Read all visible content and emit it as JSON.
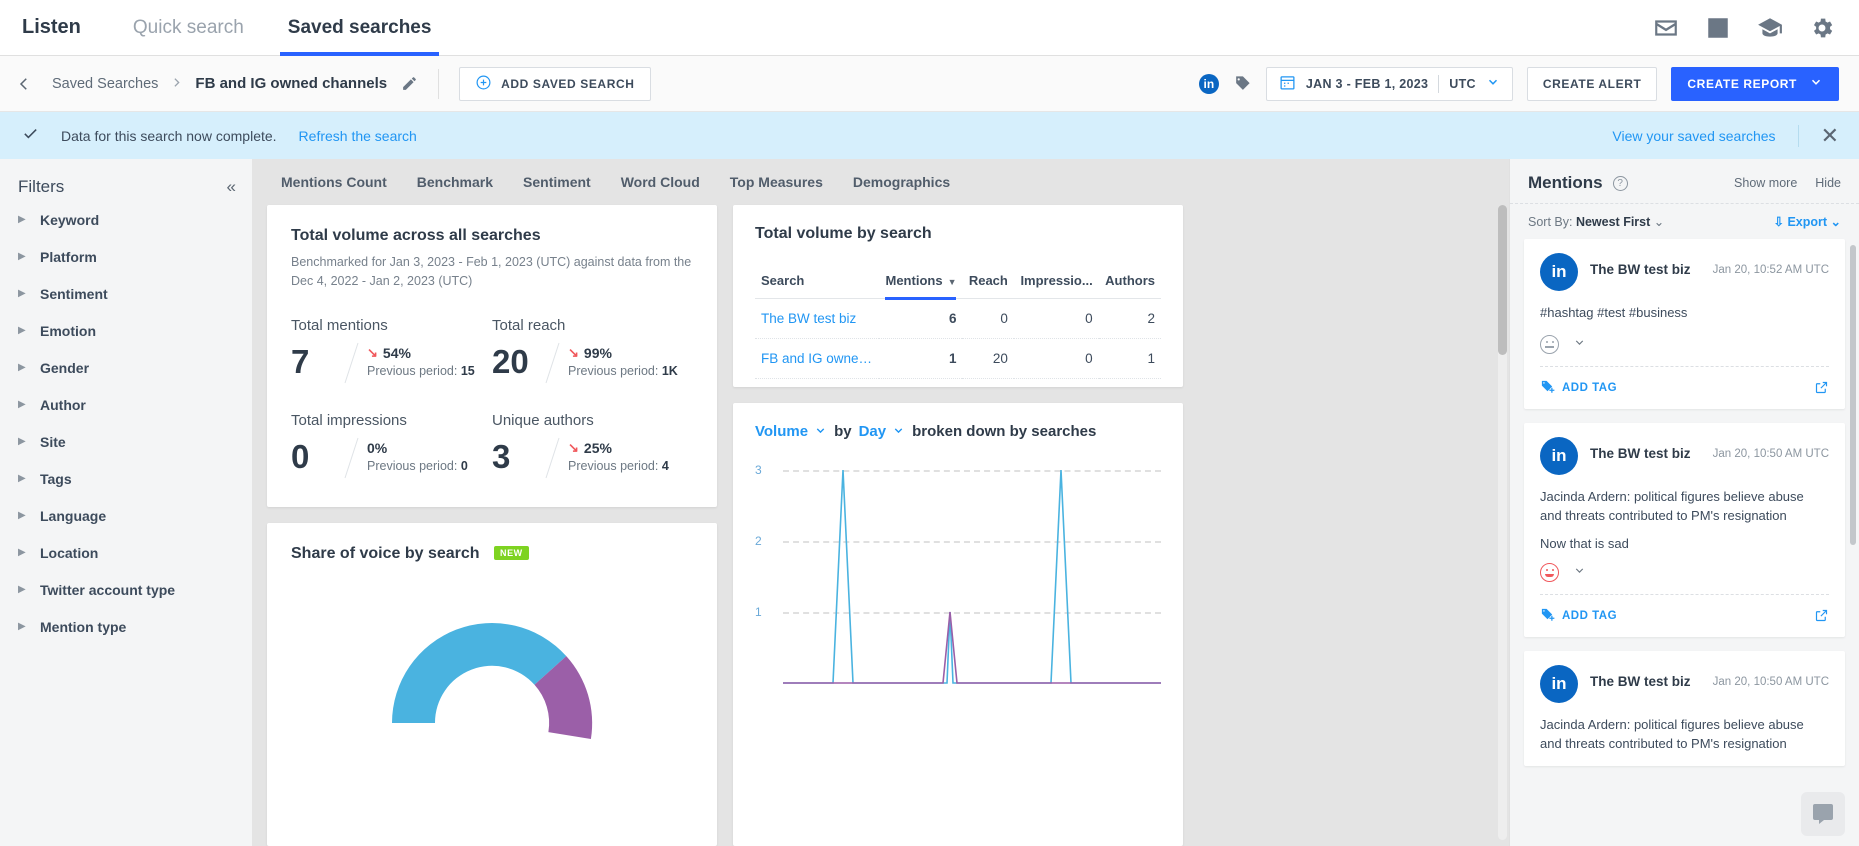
{
  "topnav": {
    "brand": "Listen",
    "tabs": [
      {
        "label": "Quick search",
        "active": false
      },
      {
        "label": "Saved searches",
        "active": true
      }
    ],
    "icons": [
      "mail-icon",
      "chart-icon",
      "academy-icon",
      "gear-icon"
    ]
  },
  "breadcrumb": {
    "parent": "Saved Searches",
    "separator": "›",
    "current": "FB and IG owned channels",
    "add_saved_search": "ADD SAVED SEARCH",
    "date_range": "JAN 3 - FEB 1, 2023",
    "timezone": "UTC",
    "create_alert": "CREATE ALERT",
    "create_report": "CREATE REPORT"
  },
  "notice": {
    "message": "Data for this search now complete.",
    "refresh_link": "Refresh the search",
    "view_link": "View your saved searches"
  },
  "sidebar": {
    "title": "Filters",
    "items": [
      {
        "label": "Keyword"
      },
      {
        "label": "Platform"
      },
      {
        "label": "Sentiment"
      },
      {
        "label": "Emotion"
      },
      {
        "label": "Gender"
      },
      {
        "label": "Author"
      },
      {
        "label": "Site"
      },
      {
        "label": "Tags"
      },
      {
        "label": "Language"
      },
      {
        "label": "Location"
      },
      {
        "label": "Twitter account type"
      },
      {
        "label": "Mention type"
      }
    ]
  },
  "tabs": [
    {
      "label": "Mentions Count"
    },
    {
      "label": "Benchmark"
    },
    {
      "label": "Sentiment"
    },
    {
      "label": "Word Cloud"
    },
    {
      "label": "Top Measures"
    },
    {
      "label": "Demographics"
    }
  ],
  "total_volume": {
    "title": "Total volume across all searches",
    "subtitle": "Benchmarked for Jan 3, 2023 - Feb 1, 2023 (UTC) against data from the Dec 4, 2022 - Jan 2, 2023 (UTC)",
    "metrics": [
      {
        "label": "Total mentions",
        "value": "7",
        "delta": "54%",
        "direction": "down",
        "previous_label": "Previous period:",
        "previous_value": "15"
      },
      {
        "label": "Total reach",
        "value": "20",
        "delta": "99%",
        "direction": "down",
        "previous_label": "Previous period:",
        "previous_value": "1K"
      },
      {
        "label": "Total impressions",
        "value": "0",
        "delta": "0%",
        "direction": "none",
        "previous_label": "Previous period:",
        "previous_value": "0"
      },
      {
        "label": "Unique authors",
        "value": "3",
        "delta": "25%",
        "direction": "down",
        "previous_label": "Previous period:",
        "previous_value": "4"
      }
    ]
  },
  "share_of_voice": {
    "title": "Share of voice by search",
    "badge": "NEW",
    "colors": {
      "primary": "#4ab3e0",
      "secondary": "#9b5fa8"
    },
    "slices": [
      {
        "label": "The BW test biz",
        "value": 6,
        "color": "#4ab3e0"
      },
      {
        "label": "FB and IG owned channels",
        "value": 1,
        "color": "#9b5fa8"
      }
    ]
  },
  "volume_by_search": {
    "title": "Total volume by search",
    "columns": [
      "Search",
      "Mentions",
      "Reach",
      "Impressio...",
      "Authors"
    ],
    "sorted_column": "Mentions",
    "rows": [
      {
        "search": "The BW test biz",
        "mentions": "6",
        "reach": "0",
        "impressions": "0",
        "authors": "2"
      },
      {
        "search": "FB and IG owne…",
        "mentions": "1",
        "reach": "20",
        "impressions": "0",
        "authors": "1"
      }
    ]
  },
  "chart_data": {
    "type": "line",
    "title": "Volume by Day broken down by searches",
    "metric_select": "Volume",
    "by_label": "by",
    "interval_select": "Day",
    "suffix_label": "broken down by searches",
    "xlabel": "",
    "ylabel": "",
    "ylim": [
      0,
      3
    ],
    "yticks": [
      1,
      2,
      3
    ],
    "grid": true,
    "legend": "none",
    "series": [
      {
        "name": "The BW test biz",
        "color": "#4ab3e0",
        "x": [
          0,
          1,
          2,
          3,
          4,
          5,
          6,
          7,
          8,
          9,
          10,
          11,
          12,
          13,
          14
        ],
        "values": [
          0,
          0,
          0,
          3,
          0,
          0,
          0,
          0,
          0,
          0,
          0,
          3,
          0,
          0,
          0
        ]
      },
      {
        "name": "FB and IG owned channels",
        "color": "#9b5fa8",
        "x": [
          0,
          1,
          2,
          3,
          4,
          5,
          6,
          7,
          8,
          9,
          10,
          11,
          12,
          13,
          14
        ],
        "values": [
          0,
          0,
          0,
          0,
          0,
          0,
          0,
          1,
          0,
          0,
          0,
          0,
          0,
          0,
          0
        ]
      }
    ]
  },
  "mentions_panel": {
    "title": "Mentions",
    "show_more": "Show more",
    "hide": "Hide",
    "sort_by_label": "Sort By:",
    "sort_by_value": "Newest First",
    "export": "Export",
    "add_tag": "ADD TAG",
    "items": [
      {
        "avatar": "linkedin-icon",
        "author": "The BW test biz",
        "time": "Jan 20, 10:52 AM UTC",
        "text": "#hashtag #test #business",
        "extra": "",
        "sentiment": "neutral"
      },
      {
        "avatar": "linkedin-icon",
        "author": "The BW test biz",
        "time": "Jan 20, 10:50 AM UTC",
        "text": "Jacinda Ardern: political figures believe abuse and threats contributed to PM's resignation",
        "extra": "Now that is sad",
        "sentiment": "negative"
      },
      {
        "avatar": "linkedin-icon",
        "author": "The BW test biz",
        "time": "Jan 20, 10:50 AM UTC",
        "text": "Jacinda Ardern: political figures believe abuse and threats contributed to PM's resignation",
        "extra": "",
        "sentiment": "neutral"
      }
    ]
  }
}
